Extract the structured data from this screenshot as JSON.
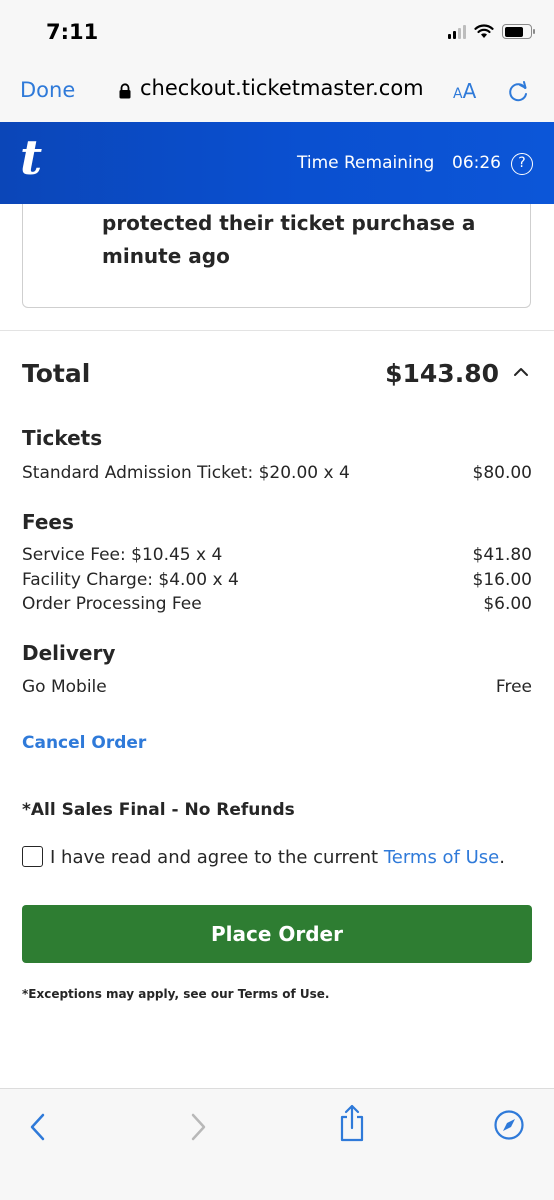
{
  "status_bar": {
    "time": "7:11",
    "battery_level": 0.75
  },
  "browser": {
    "done_label": "Done",
    "url": "checkout.ticketmaster.com",
    "text_size_small": "A",
    "text_size_large": "A"
  },
  "header": {
    "logo": "t",
    "time_remaining_label": "Time Remaining",
    "time_remaining_value": "06:26",
    "help_symbol": "?"
  },
  "protection_card": {
    "text": "protected their ticket purchase a minute ago"
  },
  "order": {
    "total_label": "Total",
    "total_amount": "$143.80",
    "tickets": {
      "title": "Tickets",
      "items": [
        {
          "label": "Standard Admission Ticket: $20.00 x 4",
          "value": "$80.00"
        }
      ]
    },
    "fees": {
      "title": "Fees",
      "items": [
        {
          "label": "Service Fee: $10.45 x 4",
          "value": "$41.80"
        },
        {
          "label": "Facility Charge: $4.00 x 4",
          "value": "$16.00"
        },
        {
          "label": "Order Processing Fee",
          "value": "$6.00"
        }
      ]
    },
    "delivery": {
      "title": "Delivery",
      "items": [
        {
          "label": "Go Mobile",
          "value": "Free"
        }
      ]
    },
    "cancel_label": "Cancel Order",
    "sales_final": "*All Sales Final - No Refunds",
    "agree_prefix": "I have read and agree to the current ",
    "agree_link": "Terms of Use",
    "agree_suffix": ".",
    "place_order_label": "Place Order",
    "exceptions_note": "*Exceptions may apply, see our Terms of Use."
  },
  "colors": {
    "brand_blue": "#0a4fcf",
    "link_blue": "#2f7ad9",
    "button_green": "#2e7d32"
  },
  "icons": [
    "lock-icon",
    "reload-icon",
    "help-icon",
    "chevron-up-icon",
    "back-icon",
    "forward-icon",
    "share-icon",
    "compass-icon"
  ]
}
